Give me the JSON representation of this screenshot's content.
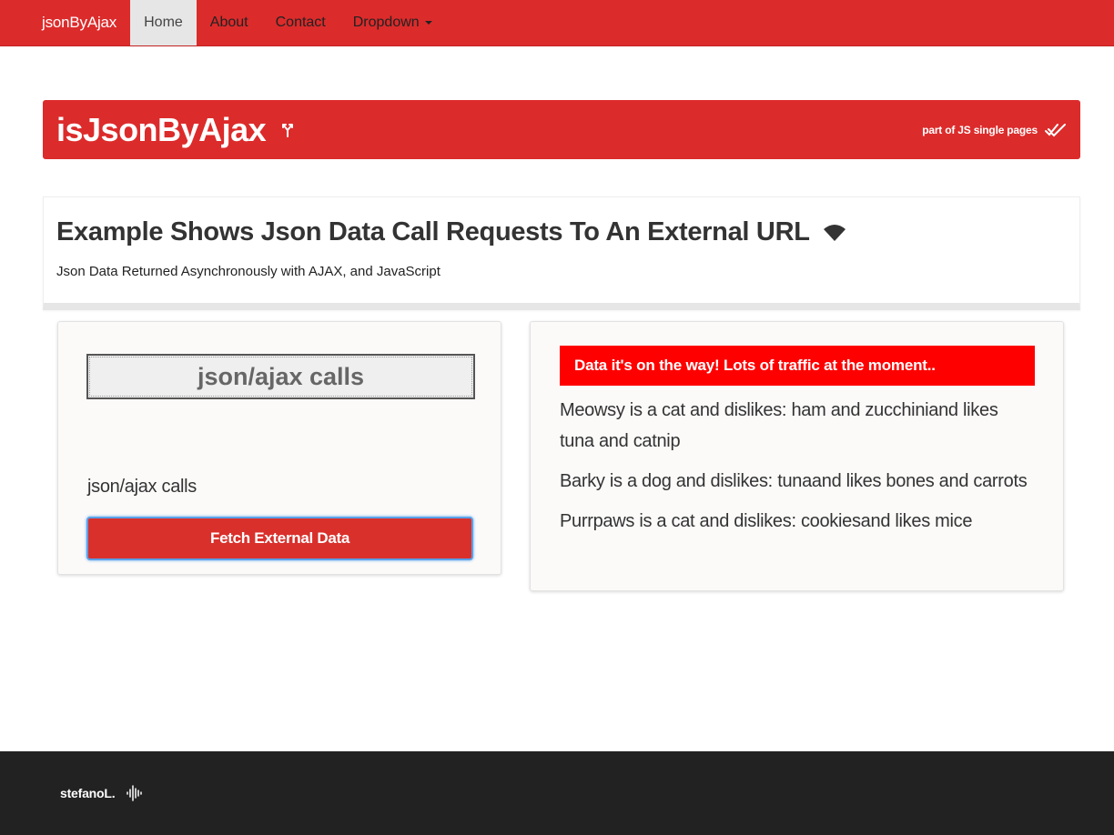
{
  "navbar": {
    "brand": "jsonByAjax",
    "items": [
      {
        "label": "Home",
        "active": true
      },
      {
        "label": "About",
        "active": false
      },
      {
        "label": "Contact",
        "active": false
      },
      {
        "label": "Dropdown",
        "active": false
      }
    ]
  },
  "banner": {
    "title": "isJsonByAjax",
    "title_icon": "fork-icon",
    "right_text": "part of JS single pages",
    "right_icon": "double-check-icon"
  },
  "intro": {
    "heading": "Example Shows Json Data Call Requests To An External URL",
    "heading_icon": "wifi-icon",
    "subtext": "Json Data Returned Asynchronously with AJAX, and JavaScript"
  },
  "left_card": {
    "box_title": "json/ajax calls",
    "label": "json/ajax calls",
    "button_label": "Fetch External Data"
  },
  "right_card": {
    "alert": "Data it's on the way! Lots of traffic at the moment..",
    "results": [
      "Meowsy is a cat and dislikes: ham and zucchiniand likes tuna and catnip",
      "Barky is a dog and dislikes: tunaand likes bones and carrots",
      "Purrpaws is a cat and dislikes: cookiesand likes mice"
    ]
  },
  "footer": {
    "author": "stefanoL.",
    "icon": "audio-wave-icon"
  },
  "colors": {
    "primary_red": "#dc2b2b",
    "alert_red": "#ff0000",
    "footer_bg": "#222222",
    "focus_blue": "#5aa0e8"
  }
}
